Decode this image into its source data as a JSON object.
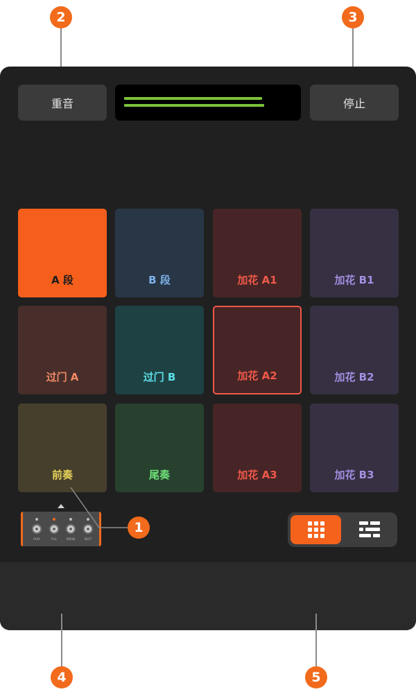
{
  "callouts": [
    "1",
    "2",
    "3",
    "4",
    "5"
  ],
  "top": {
    "reset_label": "重音",
    "stop_label": "停止"
  },
  "pads": [
    {
      "label": "A 段",
      "bg": "#f55f1b",
      "fg": "#1c1c1c",
      "selected": false
    },
    {
      "label": "B 段",
      "bg": "#283646",
      "fg": "#7db2e8",
      "selected": false
    },
    {
      "label": "加花 A1",
      "bg": "#472526",
      "fg": "#f0594a",
      "selected": false
    },
    {
      "label": "加花 B1",
      "bg": "#363042",
      "fg": "#a38de0",
      "selected": false
    },
    {
      "label": "过门 A",
      "bg": "#472e2a",
      "fg": "#f08a66",
      "selected": false
    },
    {
      "label": "过门 B",
      "bg": "#1e4144",
      "fg": "#5ce0e8",
      "selected": false
    },
    {
      "label": "加花 A2",
      "bg": "#472526",
      "fg": "#f0594a",
      "selected": true
    },
    {
      "label": "加花 B2",
      "bg": "#363042",
      "fg": "#a38de0",
      "selected": false
    },
    {
      "label": "前奏",
      "bg": "#453f2c",
      "fg": "#e8d35a",
      "selected": false
    },
    {
      "label": "尾奏",
      "bg": "#28412e",
      "fg": "#6ee07a",
      "selected": false
    },
    {
      "label": "加花 A3",
      "bg": "#472526",
      "fg": "#f0594a",
      "selected": false
    },
    {
      "label": "加花 B3",
      "bg": "#363042",
      "fg": "#a38de0",
      "selected": false
    }
  ],
  "footswitch": {
    "labels": [
      "PLAY",
      "FILL",
      "VERSE",
      "SECT"
    ],
    "led_on_index": 1
  },
  "view_toggle": {
    "active": "grid",
    "icons": [
      "grid-icon",
      "list-icon"
    ]
  },
  "colors": {
    "accent": "#f26a1b",
    "panel": "#202020",
    "meter": "#7cc23a"
  }
}
